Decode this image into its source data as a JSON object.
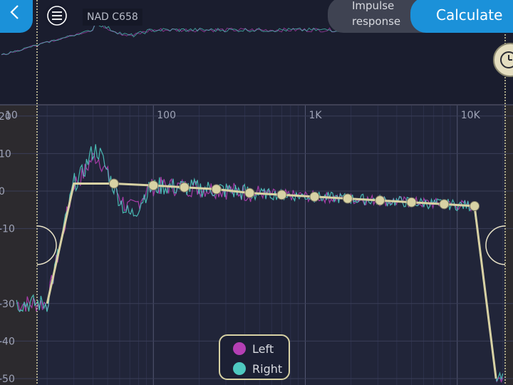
{
  "header": {
    "device_name": "NAD C658",
    "impulse_label_line1": "Impulse",
    "impulse_label_line2": "response",
    "calculate_label": "Calculate"
  },
  "icons": {
    "back": "chevron-left-icon",
    "menu": "hamburger-menu-icon",
    "history": "clock-icon"
  },
  "colors": {
    "accent": "#1b91d9",
    "left_channel": "#b43fb4",
    "right_channel": "#4ec9c0",
    "target_curve": "#d8d2a4"
  },
  "legend": [
    {
      "label": "Left",
      "color": "#b43fb4"
    },
    {
      "label": "Right",
      "color": "#4ec9c0"
    }
  ],
  "chart_data": {
    "type": "line",
    "x_scale": "log",
    "x_tick_labels": [
      "10",
      "100",
      "1K",
      "10K"
    ],
    "y_tick_labels": [
      "20",
      "10",
      "0",
      "-10",
      "-30",
      "-40",
      "-50"
    ],
    "ylim": [
      -50,
      20
    ],
    "grid": true,
    "legend_position": "bottom-center",
    "series": [
      {
        "name": "Left"
      },
      {
        "name": "Right"
      }
    ],
    "target_curve": {
      "x": [
        20,
        30,
        55,
        100,
        160,
        260,
        430,
        700,
        1150,
        1900,
        3100,
        5000,
        8200,
        13000,
        18000
      ],
      "y": [
        -30,
        2,
        2,
        1.5,
        1,
        0.5,
        -0.5,
        -1,
        -1.5,
        -2,
        -2.5,
        -3,
        -3.5,
        -4,
        -50
      ]
    },
    "control_points_hz": [
      35,
      55,
      100,
      160,
      260,
      430,
      700,
      1150,
      1900,
      3100,
      5000,
      8200,
      13000,
      18000
    ]
  }
}
